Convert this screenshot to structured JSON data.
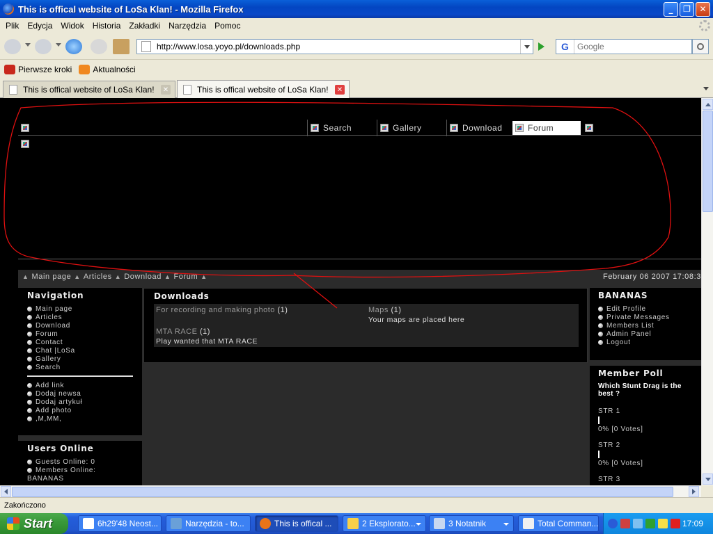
{
  "window": {
    "title": "This is offical website of LoSa Klan! - Mozilla Firefox"
  },
  "menu": [
    "Plik",
    "Edycja",
    "Widok",
    "Historia",
    "Zakładki",
    "Narzędzia",
    "Pomoc"
  ],
  "nav": {
    "url": "http://www.losa.yoyo.pl/downloads.php",
    "search_placeholder": "Google"
  },
  "bookmarks": [
    "Pierwsze kroki",
    "Aktualności"
  ],
  "tabs": [
    {
      "label": "This is offical website of LoSa Klan!",
      "active": false
    },
    {
      "label": "This is offical website of LoSa Klan!",
      "active": true
    }
  ],
  "site": {
    "top_nav": [
      "Search",
      "Gallery",
      "Download",
      "Forum"
    ],
    "breadcrumbs": [
      "Main page",
      "Articles",
      "Download",
      "Forum"
    ],
    "datetime": "February 06 2007 17:08:3",
    "navigation": {
      "title": "Navigation",
      "items": [
        "Main page",
        "Articles",
        "Download",
        "Forum",
        "Contact",
        "Chat |LoSa",
        "Gallery",
        "Search"
      ],
      "extra": [
        "Add link",
        "Dodaj newsa",
        "Dodaj artykuł",
        "Add photo",
        ",M,MM,"
      ]
    },
    "users_online": {
      "title": "Users Online",
      "guests": "Guests Online: 0",
      "members": "Members Online:",
      "member_name": "BANANAS"
    },
    "downloads": {
      "title": "Downloads",
      "categories": [
        {
          "name": "For recording and making photo",
          "count": "(1)",
          "desc": ""
        },
        {
          "name": "Maps",
          "count": "(1)",
          "desc": "Your maps are placed here"
        },
        {
          "name": "MTA RACE",
          "count": "(1)",
          "desc": "Play wanted that MTA RACE"
        }
      ]
    },
    "user_panel": {
      "title": "BANANAS",
      "items": [
        "Edit Profile",
        "Private Messages",
        "Members List",
        "Admin Panel",
        "Logout"
      ]
    },
    "poll": {
      "title": "Member Poll",
      "question": "Which Stunt Drag is the best ?",
      "options": [
        {
          "label": "STR 1",
          "result": "0% [0 Votes]",
          "percent": 0
        },
        {
          "label": "STR 2",
          "result": "0% [0 Votes]",
          "percent": 0
        },
        {
          "label": "STR 3",
          "result": "",
          "percent": 0
        }
      ]
    }
  },
  "status": "Zakończono",
  "taskbar": {
    "start": "Start",
    "tasks": [
      "6h29'48 Neost...",
      "Narzędzia - to...",
      "This is offical ...",
      "2 Eksplorato...",
      "3 Notatnik",
      "Total Comman..."
    ],
    "clock": "17:09"
  },
  "colors": {
    "annotation": "#e01010",
    "page_bg": "#000000",
    "panel_bg": "#2b2b2b"
  }
}
